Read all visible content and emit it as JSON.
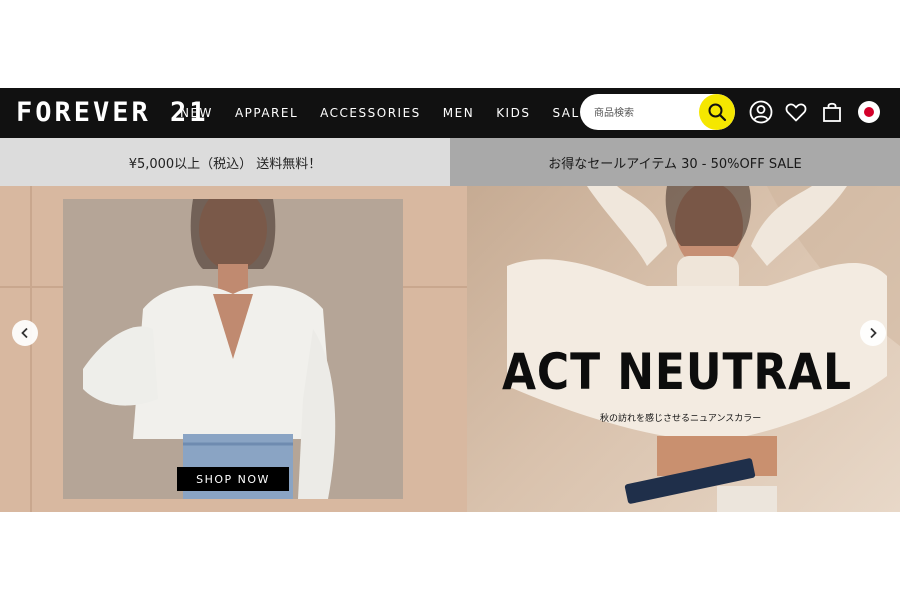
{
  "header": {
    "logo": "FOREVER 21",
    "nav": [
      "NEW",
      "APPAREL",
      "ACCESSORIES",
      "MEN",
      "KIDS",
      "SALE"
    ],
    "search": {
      "placeholder": "商品検索",
      "button_color": "#f5e700"
    },
    "icons": [
      "account-icon",
      "heart-icon",
      "bag-icon",
      "japan-flag-icon"
    ]
  },
  "promo": {
    "left": "¥5,000以上（税込） 送料無料！",
    "right": "お得なセールアイテム 30 - 50%OFF SALE"
  },
  "hero": {
    "cta": "SHOP NOW",
    "headline": "ACT NEUTRAL",
    "subheadline": "秋の訪れを感じさせるニュアンスカラー"
  },
  "colors": {
    "header_bg": "#111111",
    "promo_left_bg": "#dcdcdc",
    "promo_right_bg": "#a9a9a9",
    "accent_yellow": "#f5e700"
  }
}
